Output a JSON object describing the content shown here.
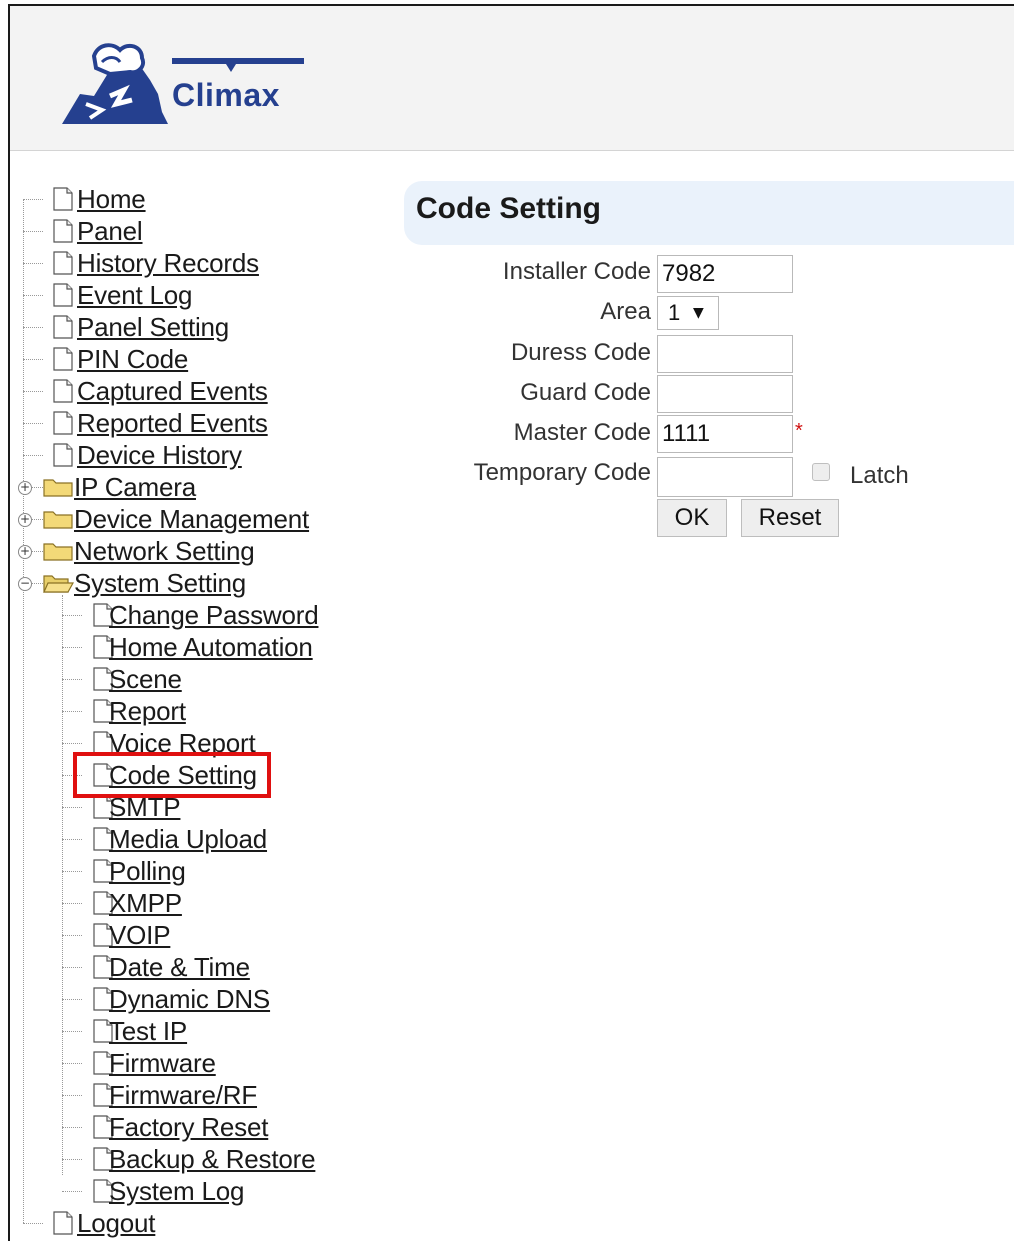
{
  "logo": {
    "text": "Climax"
  },
  "nav": {
    "items": [
      {
        "label": "Home",
        "type": "doc",
        "level": 0
      },
      {
        "label": "Panel",
        "type": "doc",
        "level": 0
      },
      {
        "label": "History Records",
        "type": "doc",
        "level": 0
      },
      {
        "label": "Event Log",
        "type": "doc",
        "level": 0
      },
      {
        "label": "Panel Setting",
        "type": "doc",
        "level": 0
      },
      {
        "label": "PIN Code",
        "type": "doc",
        "level": 0
      },
      {
        "label": "Captured Events",
        "type": "doc",
        "level": 0
      },
      {
        "label": "Reported Events",
        "type": "doc",
        "level": 0
      },
      {
        "label": "Device History",
        "type": "doc",
        "level": 0
      },
      {
        "label": "IP Camera",
        "type": "folder",
        "level": 0,
        "toggle": "+"
      },
      {
        "label": "Device Management",
        "type": "folder",
        "level": 0,
        "toggle": "+"
      },
      {
        "label": "Network Setting",
        "type": "folder",
        "level": 0,
        "toggle": "+"
      },
      {
        "label": "System Setting",
        "type": "folder-open",
        "level": 0,
        "toggle": "−"
      },
      {
        "label": "Change Password",
        "type": "doc",
        "level": 1
      },
      {
        "label": "Home Automation",
        "type": "doc",
        "level": 1
      },
      {
        "label": "Scene",
        "type": "doc",
        "level": 1
      },
      {
        "label": "Report",
        "type": "doc",
        "level": 1
      },
      {
        "label": "Voice Report",
        "type": "doc",
        "level": 1
      },
      {
        "label": "Code Setting",
        "type": "doc",
        "level": 1,
        "selected": true
      },
      {
        "label": "SMTP",
        "type": "doc",
        "level": 1
      },
      {
        "label": "Media Upload",
        "type": "doc",
        "level": 1
      },
      {
        "label": "Polling",
        "type": "doc",
        "level": 1
      },
      {
        "label": "XMPP",
        "type": "doc",
        "level": 1
      },
      {
        "label": "VOIP",
        "type": "doc",
        "level": 1
      },
      {
        "label": "Date & Time",
        "type": "doc",
        "level": 1
      },
      {
        "label": "Dynamic DNS",
        "type": "doc",
        "level": 1
      },
      {
        "label": "Test IP",
        "type": "doc",
        "level": 1
      },
      {
        "label": "Firmware",
        "type": "doc",
        "level": 1
      },
      {
        "label": "Firmware/RF",
        "type": "doc",
        "level": 1
      },
      {
        "label": "Factory Reset",
        "type": "doc",
        "level": 1
      },
      {
        "label": "Backup & Restore",
        "type": "doc",
        "level": 1
      },
      {
        "label": "System Log",
        "type": "doc",
        "level": 1
      },
      {
        "label": "Logout",
        "type": "doc",
        "level": 0
      }
    ]
  },
  "content": {
    "title": "Code Setting",
    "installer_code": {
      "label": "Installer Code",
      "value": "7982"
    },
    "area": {
      "label": "Area",
      "value": "1"
    },
    "duress_code": {
      "label": "Duress Code",
      "value": ""
    },
    "guard_code": {
      "label": "Guard Code",
      "value": ""
    },
    "master_code": {
      "label": "Master Code",
      "value": "1111",
      "required_mark": "*"
    },
    "temporary_code": {
      "label": "Temporary Code",
      "value": ""
    },
    "latch": {
      "label": "Latch",
      "checked": false
    },
    "ok_label": "OK",
    "reset_label": "Reset"
  },
  "colors": {
    "accent": "#25408f",
    "highlight": "#e01010",
    "title_bar": "#eaf2fb"
  }
}
